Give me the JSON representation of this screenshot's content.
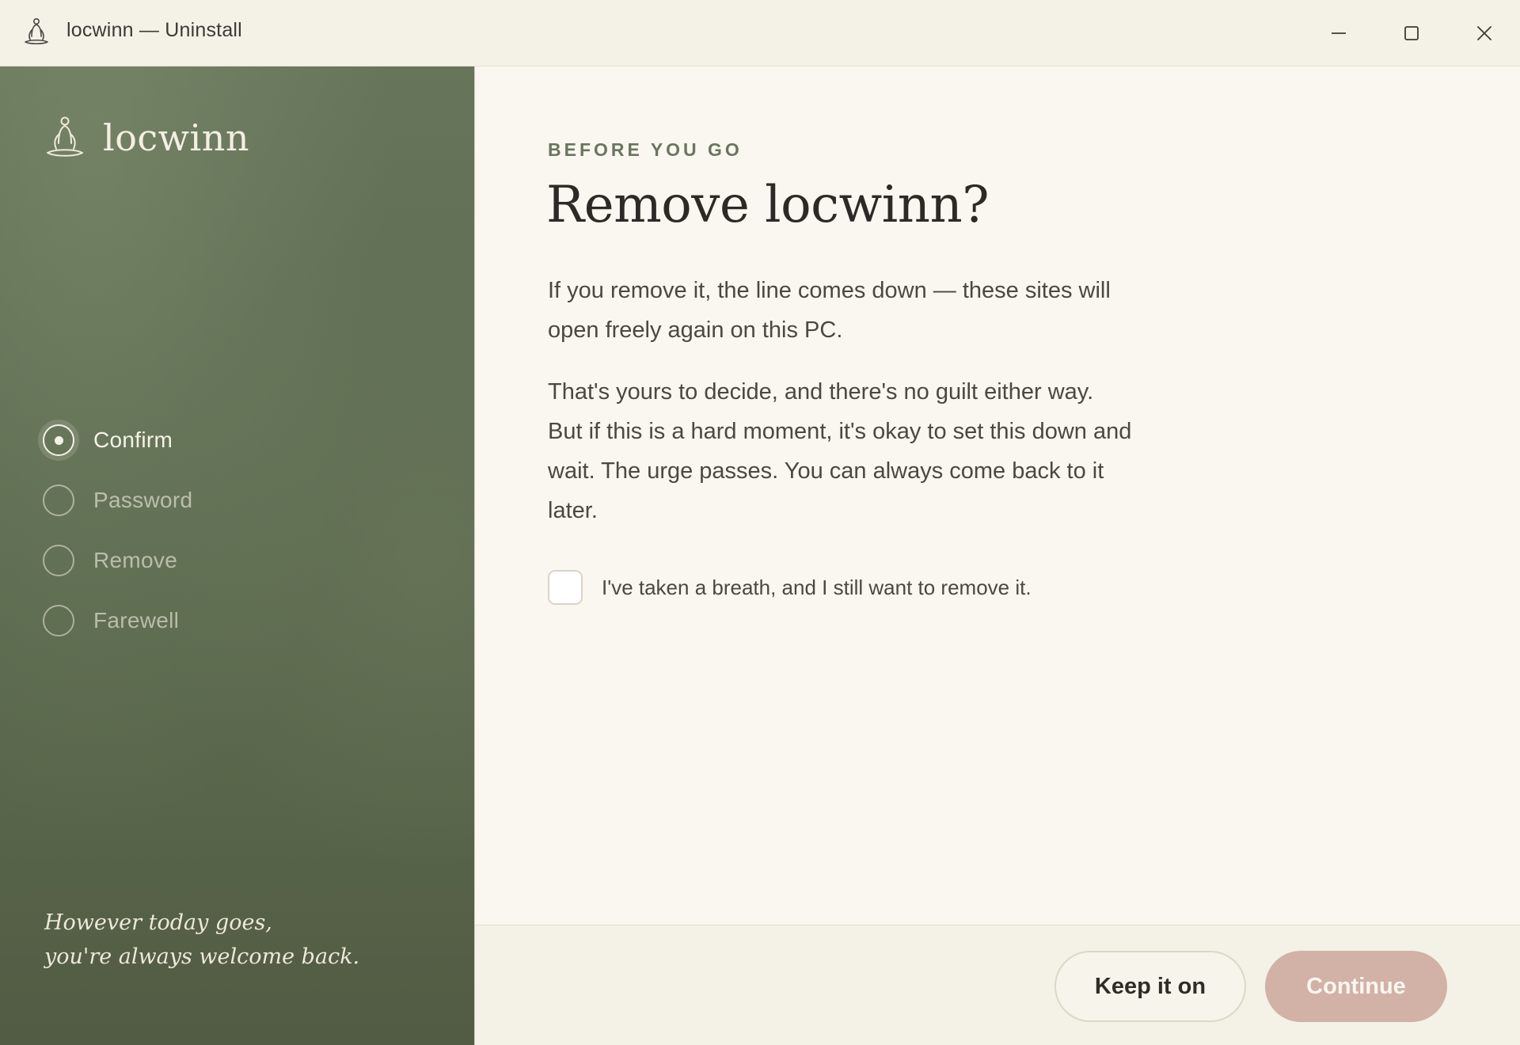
{
  "window": {
    "title": "locwinn — Uninstall",
    "controls": {
      "minimize": "minimize-icon",
      "maximize": "maximize-icon",
      "close": "close-icon"
    }
  },
  "sidebar": {
    "brand_name": "locwinn",
    "steps": [
      {
        "label": "Confirm",
        "state": "active"
      },
      {
        "label": "Password",
        "state": "pending"
      },
      {
        "label": "Remove",
        "state": "pending"
      },
      {
        "label": "Farewell",
        "state": "pending"
      }
    ],
    "quote_line1": "However today goes,",
    "quote_line2": "you're always welcome back."
  },
  "main": {
    "eyebrow": "BEFORE YOU GO",
    "heading": "Remove locwinn?",
    "paragraph1": "If you remove it, the line comes down — these sites will open freely again on this PC.",
    "paragraph2": "That's yours to decide, and there's no guilt either way. But if this is a hard moment, it's okay to set this down and wait. The urge passes. You can always come back to it later.",
    "confirm_checkbox": {
      "label": "I've taken a breath, and I still want to remove it.",
      "checked": false
    }
  },
  "footer": {
    "keep_label": "Keep it on",
    "continue_label": "Continue",
    "continue_enabled": false
  },
  "colors": {
    "sidebar": "#5c6b50",
    "accent_text": "#6a7560",
    "continue_disabled": "#d2b2a6",
    "background": "#faf7f0"
  }
}
